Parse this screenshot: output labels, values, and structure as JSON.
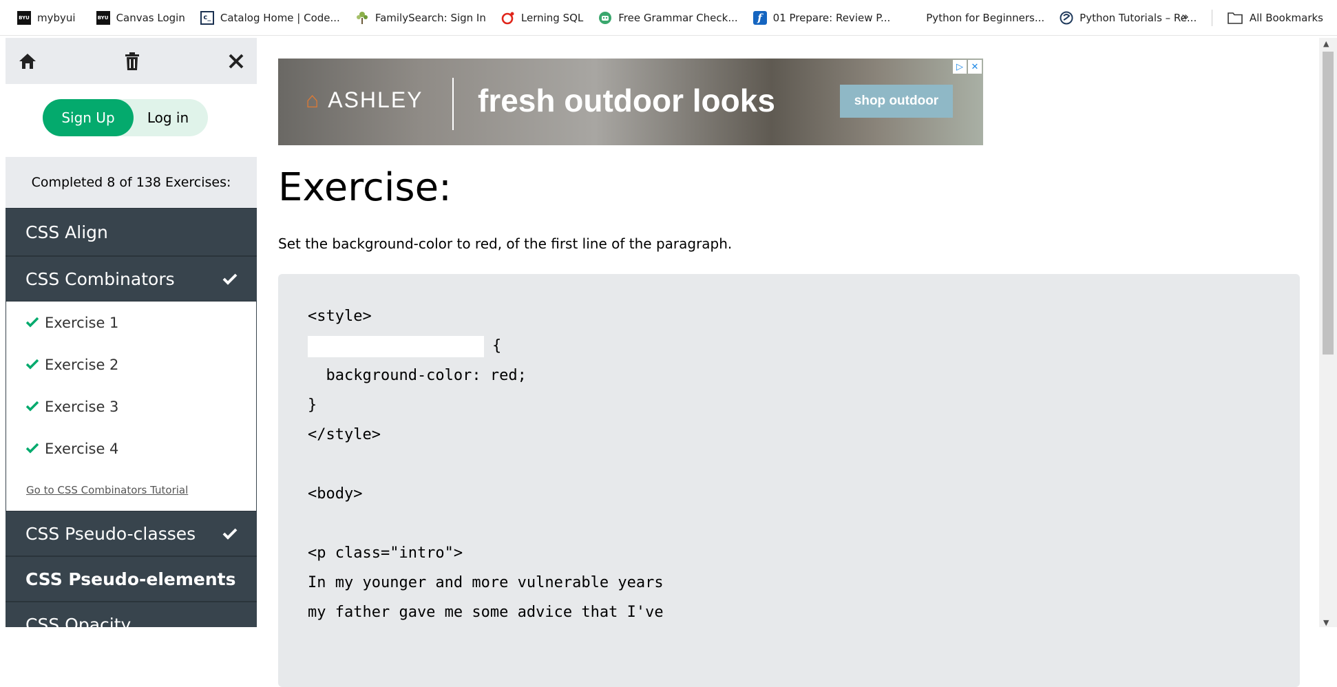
{
  "bookmarks": [
    {
      "label": "mybyui",
      "icon": "byui-logo-icon"
    },
    {
      "label": "Canvas Login",
      "icon": "byui-logo-icon"
    },
    {
      "label": "Catalog Home | Code...",
      "icon": "catalog-icon"
    },
    {
      "label": "FamilySearch: Sign In",
      "icon": "familysearch-tree-icon"
    },
    {
      "label": "Lerning SQL",
      "icon": "oracle-icon"
    },
    {
      "label": "Free Grammar Check...",
      "icon": "robot-icon"
    },
    {
      "label": "01 Prepare: Review P...",
      "icon": "f-logo-icon"
    },
    {
      "label": "Python for Beginners...",
      "icon": "microsoft-logo-icon"
    },
    {
      "label": "Python Tutorials – Re...",
      "icon": "python-icon"
    }
  ],
  "bookmarks_more": "»",
  "all_bookmarks": "All Bookmarks",
  "sidebar": {
    "signup_label": "Sign Up",
    "login_label": "Log in",
    "completed_text": "Completed 8 of 138 Exercises:",
    "topics_before": [
      {
        "label": "CSS Align",
        "completed": false
      }
    ],
    "active_topic": {
      "label": "CSS Combinators",
      "completed": true
    },
    "exercises": [
      {
        "label": "Exercise 1"
      },
      {
        "label": "Exercise 2"
      },
      {
        "label": "Exercise 3"
      },
      {
        "label": "Exercise 4"
      }
    ],
    "tutorial_link": "Go to CSS Combinators Tutorial",
    "topics_after": [
      {
        "label": "CSS Pseudo-classes",
        "completed": true
      },
      {
        "label": "CSS Pseudo-elements",
        "completed": false
      },
      {
        "label": "CSS Opacity",
        "completed": false
      }
    ]
  },
  "ad": {
    "brand": "ASHLEY",
    "headline": "fresh outdoor looks",
    "cta": "shop outdoor"
  },
  "exercise": {
    "title": "Exercise:",
    "description": "Set the background-color to red, of the first line of the paragraph.",
    "code_lines": [
      "<style>",
      "__BLANK__ {",
      "  background-color: red;",
      "}",
      "</style>",
      "",
      "<body>",
      "",
      "<p class=\"intro\">",
      "In my younger and more vulnerable years",
      "my father gave me some advice that I've"
    ]
  },
  "colors": {
    "accent": "#04aa6d",
    "sidebar_dark": "#38444d"
  }
}
